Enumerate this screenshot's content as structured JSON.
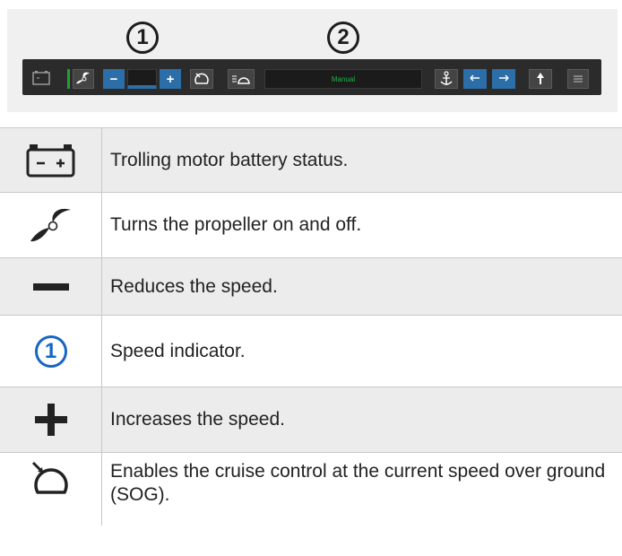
{
  "toolbar": {
    "callouts": [
      "1",
      "2"
    ],
    "mode_label": "Manual",
    "minus_glyph": "−",
    "plus_glyph": "+"
  },
  "rows": [
    {
      "icon": "battery-icon",
      "text": "Trolling motor battery status."
    },
    {
      "icon": "propeller-icon",
      "text": "Turns the propeller on and off."
    },
    {
      "icon": "minus-icon",
      "text": "Reduces the speed."
    },
    {
      "icon": "callout-1-icon",
      "icon_text": "1",
      "text": "Speed indicator."
    },
    {
      "icon": "plus-icon",
      "text": "Increases the speed."
    },
    {
      "icon": "cruise-control-icon",
      "text": "Enables the cruise control at the current speed over ground (SOG)."
    }
  ],
  "colors": {
    "accent_blue": "#1766c4",
    "toolbar_bg": "#2b2b2b",
    "manual_green": "#22b04a",
    "toolbar_button_blue": "#2c6ea8"
  }
}
